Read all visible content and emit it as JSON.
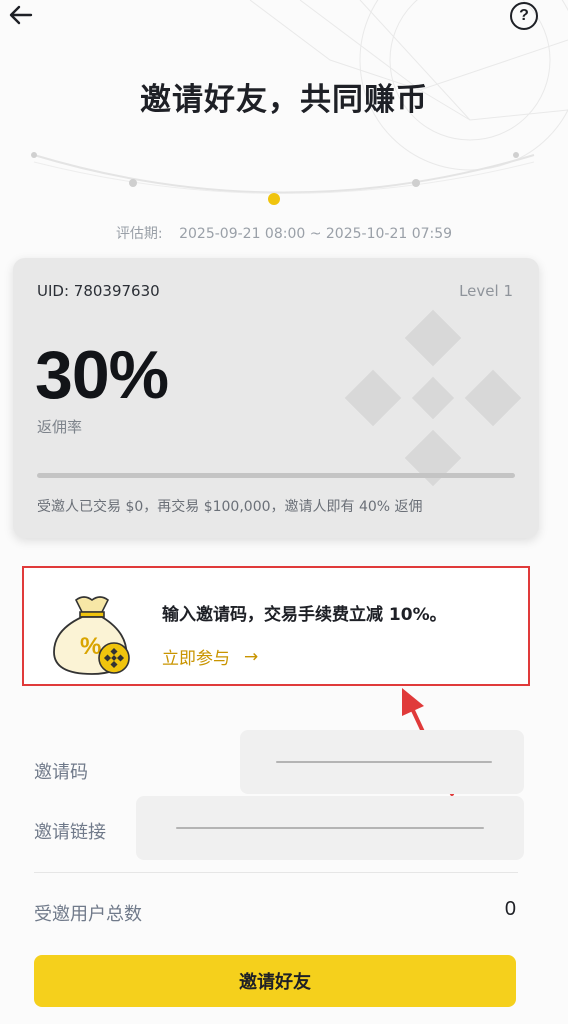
{
  "header": {
    "back_icon": "arrow-left-icon",
    "help_icon": "question-circle-icon",
    "help_glyph": "?"
  },
  "title": "邀请好友，共同赚币",
  "period": {
    "label": "评估期:",
    "range": "2025-09-21 08:00 ~ 2025-10-21 07:59"
  },
  "card": {
    "uid": "UID: 780397630",
    "level": "Level 1",
    "rate": "30%",
    "rate_label": "返佣率",
    "progress": 0,
    "progress_text": "受邀人已交易 $0，再交易 $100,000，邀请人即有 40% 返佣"
  },
  "promo": {
    "text": "输入邀请码，交易手续费立减 10%。",
    "link": "立即参与",
    "link_arrow": "→"
  },
  "form": {
    "invite_code_label": "邀请码",
    "invite_link_label": "邀请链接",
    "total_label": "受邀用户总数",
    "total_value": "0"
  },
  "invite_button": "邀请好友",
  "colors": {
    "accent": "#F5D01C",
    "link": "#C99400",
    "highlight_border": "#E03A3A"
  }
}
